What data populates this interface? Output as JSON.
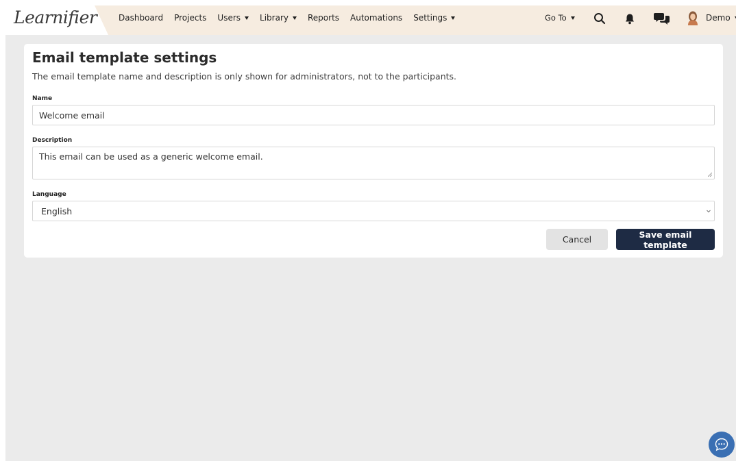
{
  "brand": {
    "logo": "Learnifier"
  },
  "nav": {
    "items": [
      {
        "label": "Dashboard",
        "dropdown": false
      },
      {
        "label": "Projects",
        "dropdown": false
      },
      {
        "label": "Users",
        "dropdown": true
      },
      {
        "label": "Library",
        "dropdown": true
      },
      {
        "label": "Reports",
        "dropdown": false
      },
      {
        "label": "Automations",
        "dropdown": false
      },
      {
        "label": "Settings",
        "dropdown": true
      }
    ],
    "goto_label": "Go To",
    "user_label": "Demo"
  },
  "icons": {
    "search": "search-icon",
    "notifications": "bell-icon",
    "chat": "chat-bubbles-icon",
    "avatar": "user-avatar",
    "support": "support-chat-icon"
  },
  "form": {
    "title": "Email template settings",
    "subtitle": "The email template name and description is only shown for administrators, not to the participants.",
    "name_label": "Name",
    "name_value": "Welcome email",
    "description_label": "Description",
    "description_value": "This email can be used as a generic welcome email.",
    "language_label": "Language",
    "language_value": "English",
    "cancel_label": "Cancel",
    "save_label": "Save email template"
  },
  "colors": {
    "header_bg": "#f6ece0",
    "page_bg": "#ebebeb",
    "primary_button": "#1e2b44",
    "secondary_button": "#e3e3e3",
    "chat_fab": "#3a6fb3"
  }
}
